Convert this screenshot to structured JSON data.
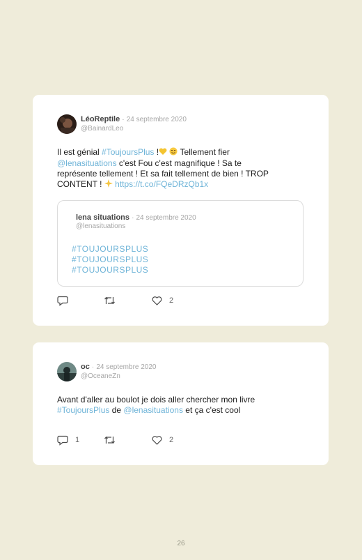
{
  "tweets": [
    {
      "author": "LéoReptile",
      "date": "24 septembre 2020",
      "handle": "@BainardLeo",
      "text": {
        "p1": "Il est génial ",
        "tag1": "#ToujoursPlus",
        "p2": " !",
        "p3": " Tellement fier ",
        "mention": "@lenasituations",
        "p4": " c'est Fou c'est magnifique ! Sa te représente tellement ! Et sa fait tellement de bien ! TROP CONTENT ! ",
        "url": "https://t.co/FQeDRzQb1x"
      },
      "quote": {
        "author": "lena situations",
        "date": "24 septembre 2020",
        "handle": "@lenasituations",
        "tags": [
          "#TOUJOURSPLUS",
          "#TOUJOURSPLUS",
          "#TOUJOURSPLUS"
        ]
      },
      "replies": "",
      "likes": "2"
    },
    {
      "author": "oc",
      "date": "24 septembre 2020",
      "handle": "@OceaneZn",
      "text": {
        "p1": "Avant d'aller au boulot je dois aller chercher mon livre ",
        "tag1": "#ToujoursPlus",
        "p2": " de ",
        "mention": "@lenasituations",
        "p3": " et ça c'est cool"
      },
      "replies": "1",
      "likes": "2"
    }
  ],
  "page_number": "26",
  "colors": {
    "background": "#efecda",
    "link": "#6fb4d8",
    "muted": "#a6a6a6"
  },
  "icons": [
    "reply-icon",
    "retweet-icon",
    "heart-icon",
    "yellow-heart-emoji",
    "smiling-face-emoji",
    "sparkles-emoji"
  ]
}
